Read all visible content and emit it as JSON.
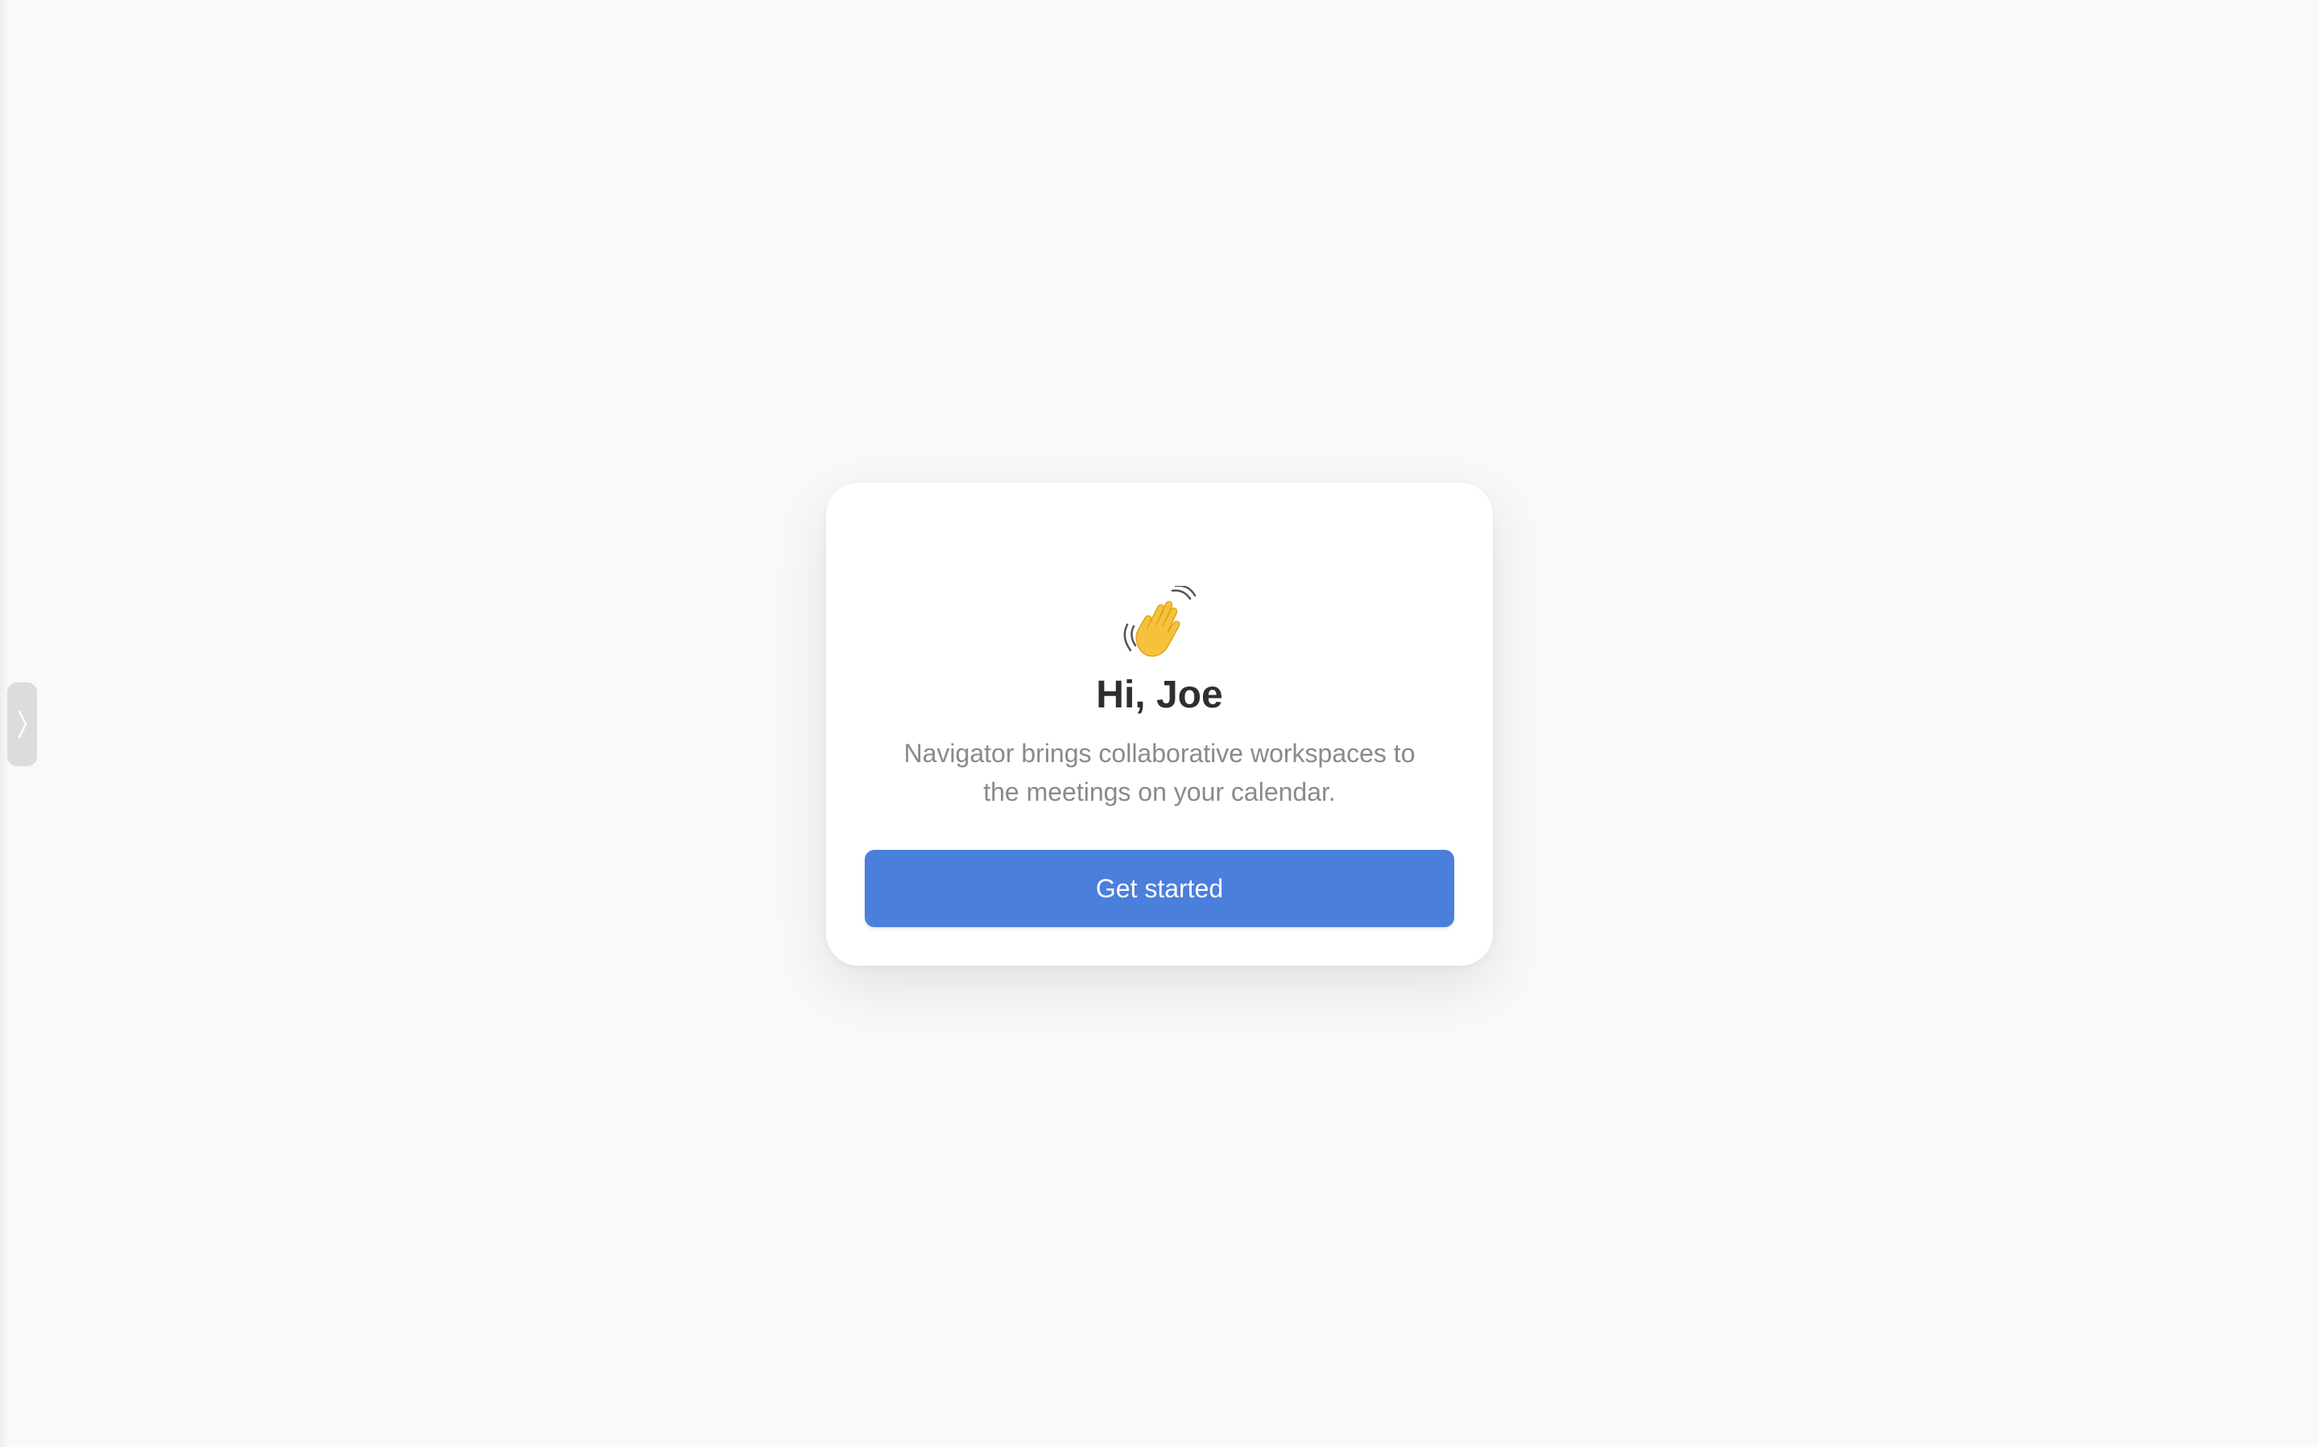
{
  "sidebar": {
    "toggle_icon": "chevron-right-icon"
  },
  "welcome": {
    "emoji_icon": "waving-hand-icon",
    "title": "Hi, Joe",
    "subtitle": "Navigator brings collaborative workspaces to\nthe meetings on your calendar.",
    "cta_label": "Get started"
  },
  "colors": {
    "background": "#faf9f7",
    "card": "#ffffff",
    "accent": "#4a7fdc",
    "title_text": "#2f2f2f",
    "subtitle_text": "#8a8a8a"
  }
}
